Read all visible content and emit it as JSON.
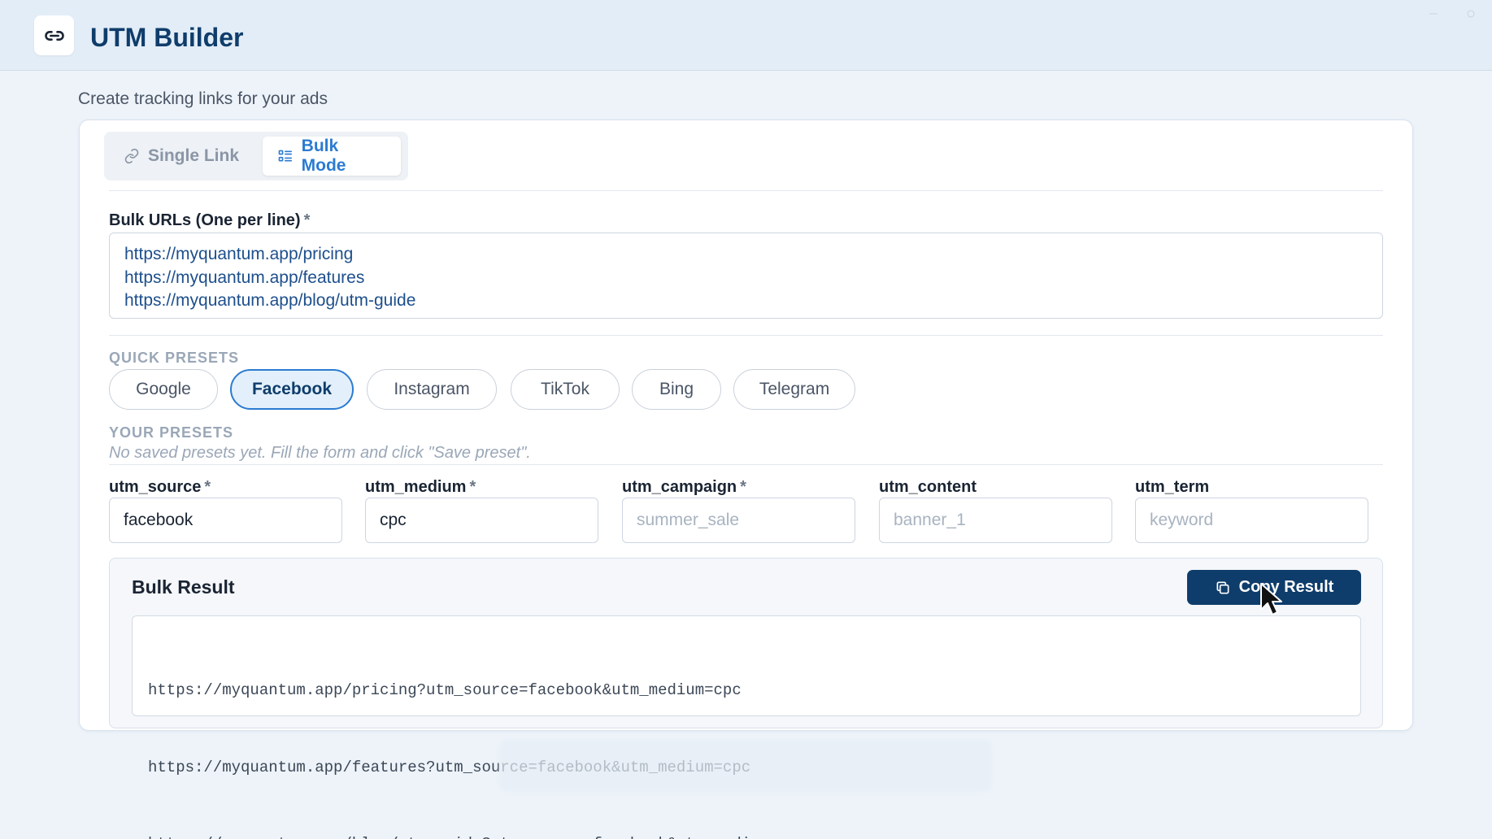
{
  "app": {
    "title": "UTM Builder",
    "icon": "link-icon",
    "subtitle": "Create tracking links for your ads"
  },
  "tabs": [
    {
      "label": "Single Link",
      "icon": "link-icon",
      "active": false
    },
    {
      "label": "Bulk Mode",
      "icon": "list-icon",
      "active": true
    }
  ],
  "bulk_urls": {
    "label": "Bulk URLs (One per line)",
    "required_mark": "*",
    "lines": [
      "https://myquantum.app/pricing",
      "https://myquantum.app/features",
      "https://myquantum.app/blog/utm-guide"
    ]
  },
  "quick_presets": {
    "heading": "QUICK PRESETS",
    "items": [
      "Google",
      "Facebook",
      "Instagram",
      "TikTok",
      "Bing",
      "Telegram"
    ],
    "selected": "Facebook"
  },
  "your_presets": {
    "heading": "YOUR PRESETS",
    "empty_text": "No saved presets yet. Fill the form and click \"Save preset\"."
  },
  "fields": [
    {
      "label": "utm_source",
      "required": true,
      "value": "facebook",
      "placeholder": ""
    },
    {
      "label": "utm_medium",
      "required": true,
      "value": "cpc",
      "placeholder": ""
    },
    {
      "label": "utm_campaign",
      "required": true,
      "value": "",
      "placeholder": "summer_sale"
    },
    {
      "label": "utm_content",
      "required": false,
      "value": "",
      "placeholder": "banner_1"
    },
    {
      "label": "utm_term",
      "required": false,
      "value": "",
      "placeholder": "keyword"
    }
  ],
  "result": {
    "title": "Bulk Result",
    "copy_label": "Copy Result",
    "copy_icon": "copy-icon",
    "lines": [
      "https://myquantum.app/pricing?utm_source=facebook&utm_medium=cpc",
      "https://myquantum.app/features?utm_source=facebook&utm_medium=cpc",
      "https://myquantum.app/blog/utm-guide?utm_source=facebook&utm_medium=cpc"
    ]
  },
  "colors": {
    "accent": "#2b7bd1",
    "primary_dark": "#0f3d6b",
    "background": "#edf3f9"
  }
}
